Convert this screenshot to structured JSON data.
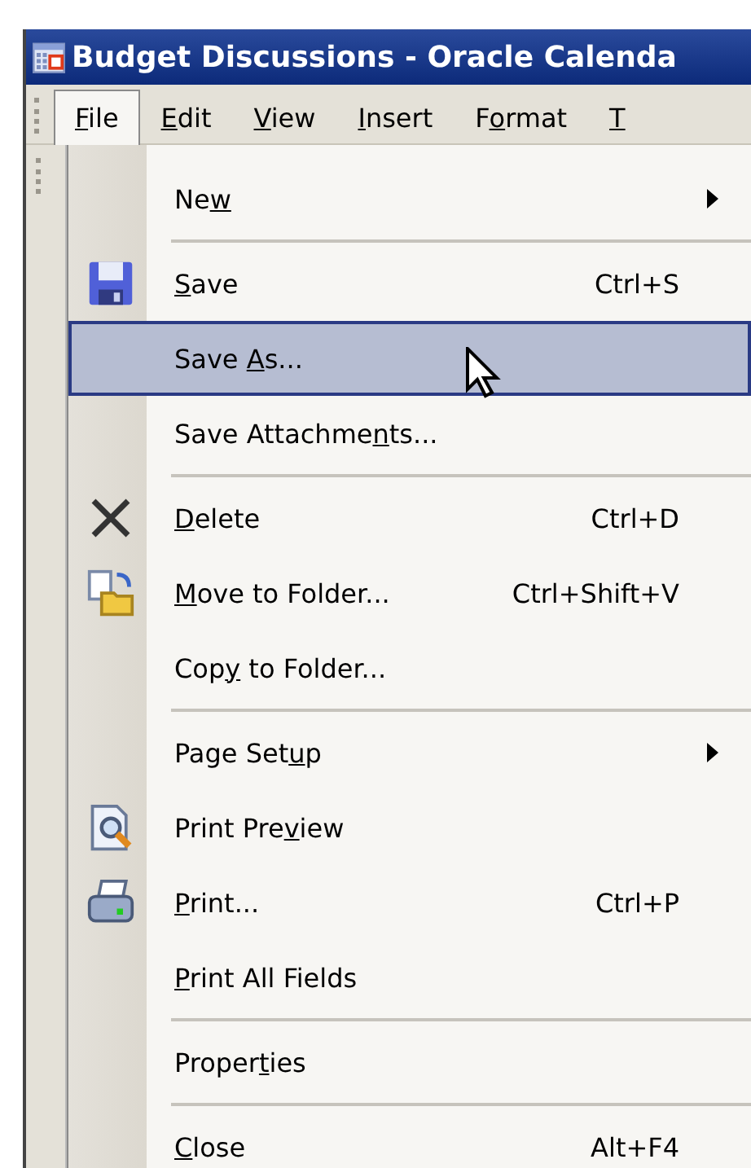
{
  "window": {
    "title": "Budget Discussions - Oracle Calenda"
  },
  "menubar": [
    {
      "access_key": "F",
      "label_end": "ile",
      "selected": true
    },
    {
      "access_key": "E",
      "label_end": "dit",
      "selected": false
    },
    {
      "access_key": "V",
      "label_end": "iew",
      "selected": false
    },
    {
      "access_key": "I",
      "label_end": "nsert",
      "selected": false
    },
    {
      "label_start": "F",
      "access_key": "o",
      "label_end": "rmat",
      "selected": false
    },
    {
      "access_key": "T",
      "selected": false
    }
  ],
  "menu": [
    {
      "label_start": "Ne",
      "access_key": "w",
      "submenu": true,
      "selected": false,
      "separator_after": true
    },
    {
      "access_key": "S",
      "label_end": "ave",
      "shortcut": "Ctrl+S",
      "submenu": false,
      "selected": false,
      "separator_after": false
    },
    {
      "label_start": "Save ",
      "access_key": "A",
      "label_end": "s...",
      "submenu": false,
      "selected": true,
      "separator_after": false
    },
    {
      "label_start": "Save Attachme",
      "access_key": "n",
      "label_end": "ts...",
      "submenu": false,
      "selected": false,
      "separator_after": true
    },
    {
      "access_key": "D",
      "label_end": "elete",
      "shortcut": "Ctrl+D",
      "submenu": false,
      "selected": false,
      "separator_after": false
    },
    {
      "access_key": "M",
      "label_end": "ove to Folder...",
      "shortcut": "Ctrl+Shift+V",
      "submenu": false,
      "selected": false,
      "separator_after": false
    },
    {
      "label_start": "Cop",
      "access_key": "y",
      "label_end": " to Folder...",
      "submenu": false,
      "selected": false,
      "separator_after": true
    },
    {
      "label_start": "Page Set",
      "access_key": "u",
      "label_end": "p",
      "submenu": true,
      "selected": false,
      "separator_after": false
    },
    {
      "label_start": "Print Pre",
      "access_key": "v",
      "label_end": "iew",
      "submenu": false,
      "selected": false,
      "separator_after": false
    },
    {
      "access_key": "P",
      "label_end": "rint...",
      "shortcut": "Ctrl+P",
      "submenu": false,
      "selected": false,
      "separator_after": false
    },
    {
      "access_key": "P",
      "label_end": "rint All Fields",
      "submenu": false,
      "selected": false,
      "separator_after": true
    },
    {
      "label_start": "Proper",
      "access_key": "t",
      "label_end": "ies",
      "submenu": false,
      "selected": false,
      "separator_after": true
    },
    {
      "access_key": "C",
      "label_end": "lose",
      "shortcut": "Alt+F4",
      "submenu": false,
      "selected": false,
      "separator_after": false
    }
  ]
}
